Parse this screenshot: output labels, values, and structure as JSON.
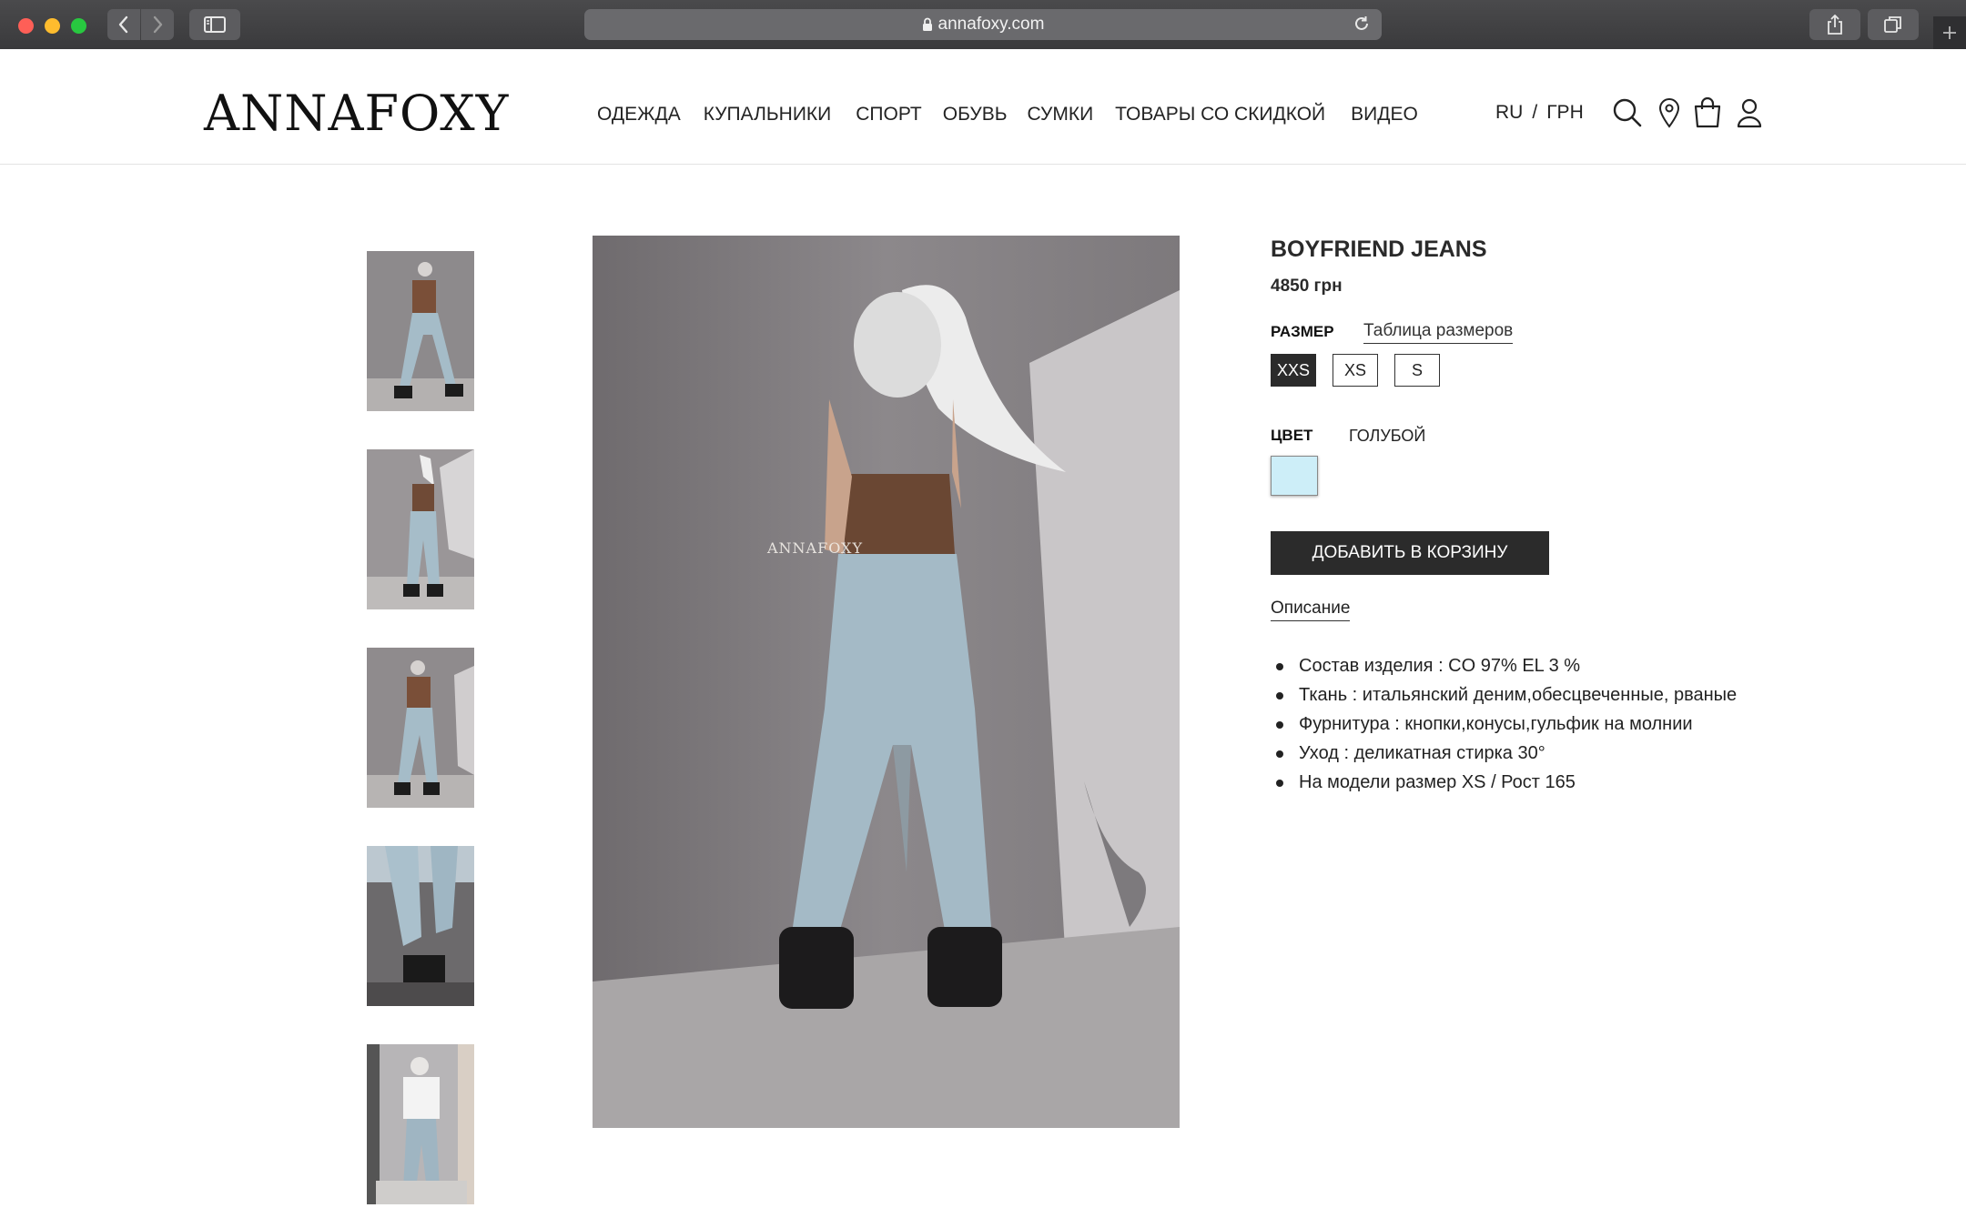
{
  "browser": {
    "url": "annafoxy.com",
    "icons": [
      "back-icon",
      "forward-icon",
      "sidebar-icon",
      "lock-icon",
      "reload-icon",
      "share-icon",
      "tabs-icon",
      "plus-icon"
    ]
  },
  "header": {
    "logo": "ANNAFOXY",
    "nav": [
      "ОДЕЖДА",
      "КУПАЛЬНИКИ",
      "СПОРТ",
      "ОБУВЬ",
      "СУМКИ",
      "ТОВАРЫ СО СКИДКОЙ",
      "ВИДЕО"
    ],
    "language": "RU",
    "separator": "/",
    "currency": "ГРН",
    "icons": [
      "search-icon",
      "location-pin-icon",
      "shopping-bag-icon",
      "user-icon"
    ]
  },
  "gallery": {
    "thumbnail_count": 5,
    "main_image_watermark": "ANNAFOXY"
  },
  "product": {
    "title": "BOYFRIEND JEANS",
    "price": "4850 грн",
    "size_label": "РАЗМЕР",
    "size_chart_link": "Таблица размеров",
    "sizes": [
      "XXS",
      "XS",
      "S"
    ],
    "selected_size": "XXS",
    "color_label": "ЦВЕТ",
    "color_name": "ГОЛУБОЙ",
    "color_swatch": "#cdeef8",
    "add_to_cart": "ДОБАВИТЬ В КОРЗИНУ",
    "description_tab": "Описание",
    "description": [
      "Состав изделия : CO 97% EL 3 %",
      "Ткань : итальянский деним,обесцвеченные, рваные",
      "Фурнитура : кнопки,конусы,гульфик на молнии",
      "Уход : деликатная стирка 30°",
      "На модели размер XS / Рост 165"
    ]
  },
  "colors": {
    "chrome": "#3c3c3e",
    "button_dark": "#2b2b2b",
    "accent_swatch": "#cdeef8"
  }
}
